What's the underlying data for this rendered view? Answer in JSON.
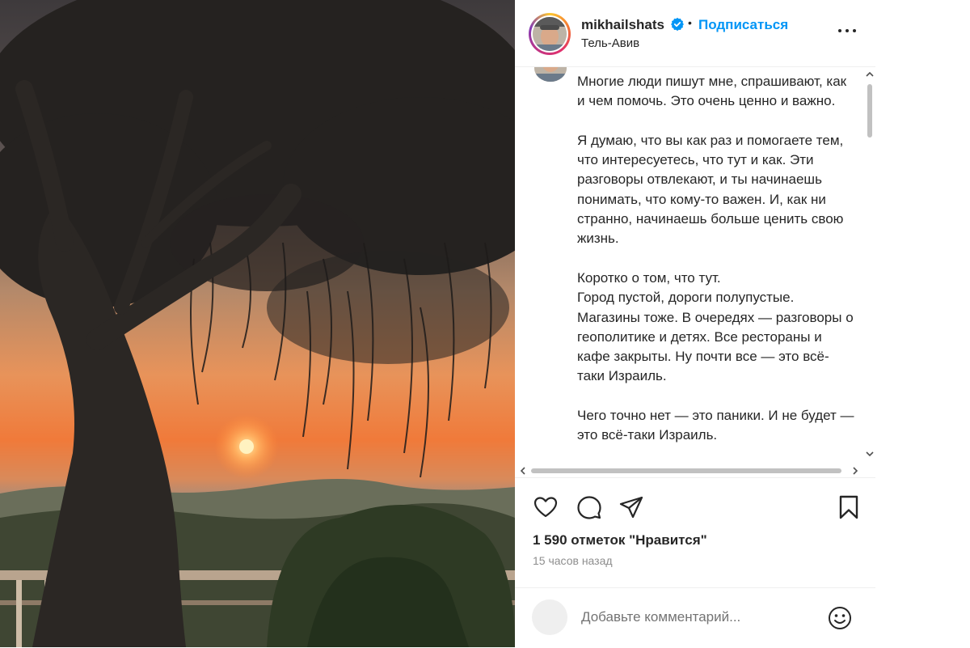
{
  "post": {
    "username": "mikhailshats",
    "follow_label": "Подписаться",
    "dot": "•",
    "location": "Тель-Авив",
    "caption": {
      "p1": "Многие люди пишут мне, спрашивают, как и чем помочь. Это очень ценно и важно.",
      "p2": "Я думаю, что вы как раз и помогаете тем, что интересуетесь, что тут и как. Эти разговоры отвлекают, и ты начинаешь понимать, что кому-то важен. И, как ни странно, начинаешь больше ценить свою жизнь.",
      "p3a": "Коротко о том, что тут.",
      "p3b": "Город пустой, дороги полупустые. Магазины тоже. В очередях — разговоры о геополитике и детях. Все рестораны и кафе закрыты. Ну почти все — это всё-таки Израиль.",
      "p4": "Чего точно нет — это паники. И не будет — это всё-таки Израиль."
    },
    "likes_text": "1 590 отметок \"Нравится\"",
    "time_ago": "15 часов назад",
    "comment_placeholder": "Добавьте комментарий..."
  },
  "icons": {
    "more": "more-options-icon",
    "verified": "verified-badge-icon",
    "like": "heart-icon",
    "comment": "comment-icon",
    "share": "share-icon",
    "save": "bookmark-icon",
    "emoji": "emoji-icon"
  },
  "colors": {
    "accent": "#0095f6",
    "text": "#262626",
    "muted": "#8e8e8e",
    "border": "#efefef"
  }
}
